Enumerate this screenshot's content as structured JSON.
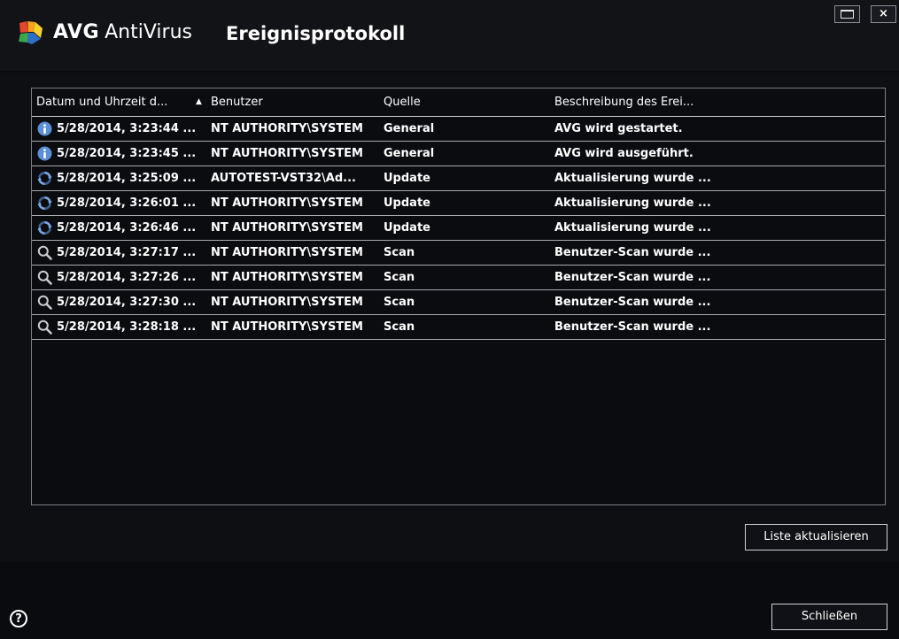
{
  "app": {
    "brand_name": "AVG",
    "product_name": "AntiVirus",
    "window_title": "Ereignisprotokoll"
  },
  "window_controls": {
    "maximize_icon": "maximize-icon",
    "close_label": "×"
  },
  "table": {
    "columns": [
      {
        "key": "date",
        "label": "Datum und Uhrzeit d...",
        "sorted": "ascending"
      },
      {
        "key": "user",
        "label": "Benutzer"
      },
      {
        "key": "source",
        "label": "Quelle"
      },
      {
        "key": "description",
        "label": "Beschreibung des Erei..."
      }
    ],
    "sort_icon": "▲",
    "rows": [
      {
        "icon": "info-icon",
        "date": "5/28/2014, 3:23:44 ...",
        "user": "NT AUTHORITY\\SYSTEM",
        "source": "General",
        "description": "AVG wird gestartet."
      },
      {
        "icon": "info-icon",
        "date": "5/28/2014, 3:23:45 ...",
        "user": "NT AUTHORITY\\SYSTEM",
        "source": "General",
        "description": "AVG wird ausgeführt."
      },
      {
        "icon": "update-icon",
        "date": "5/28/2014, 3:25:09 ...",
        "user": "AUTOTEST-VST32\\Ad...",
        "source": "Update",
        "description": "Aktualisierung wurde ..."
      },
      {
        "icon": "update-icon",
        "date": "5/28/2014, 3:26:01 ...",
        "user": "NT AUTHORITY\\SYSTEM",
        "source": "Update",
        "description": "Aktualisierung wurde ..."
      },
      {
        "icon": "update-icon",
        "date": "5/28/2014, 3:26:46 ...",
        "user": "NT AUTHORITY\\SYSTEM",
        "source": "Update",
        "description": "Aktualisierung wurde ..."
      },
      {
        "icon": "scan-icon",
        "date": "5/28/2014, 3:27:17 ...",
        "user": "NT AUTHORITY\\SYSTEM",
        "source": "Scan",
        "description": "Benutzer-Scan wurde ..."
      },
      {
        "icon": "scan-icon",
        "date": "5/28/2014, 3:27:26 ...",
        "user": "NT AUTHORITY\\SYSTEM",
        "source": "Scan",
        "description": "Benutzer-Scan wurde ..."
      },
      {
        "icon": "scan-icon",
        "date": "5/28/2014, 3:27:30 ...",
        "user": "NT AUTHORITY\\SYSTEM",
        "source": "Scan",
        "description": "Benutzer-Scan wurde ..."
      },
      {
        "icon": "scan-icon",
        "date": "5/28/2014, 3:28:18 ...",
        "user": "NT AUTHORITY\\SYSTEM",
        "source": "Scan",
        "description": "Benutzer-Scan wurde ..."
      }
    ]
  },
  "buttons": {
    "refresh_label": "Liste aktualisieren",
    "close_label": "Schließen",
    "help_label": "?"
  },
  "colors": {
    "background": "#0a0b0f",
    "info_icon": "#5b8fd6",
    "update_icon": "#7aa6e0",
    "scan_icon": "#c9cbd0"
  }
}
